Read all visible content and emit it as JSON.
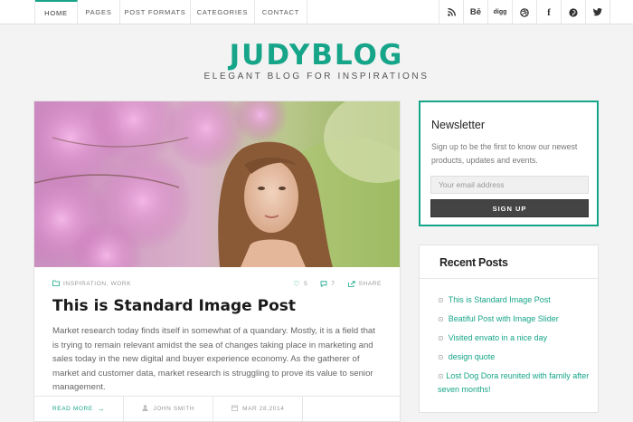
{
  "nav": {
    "items": [
      {
        "label": "HOME",
        "active": true
      },
      {
        "label": "PAGES",
        "active": false
      },
      {
        "label": "POST FORMATS",
        "active": false
      },
      {
        "label": "CATEGORIES",
        "active": false
      },
      {
        "label": "CONTACT",
        "active": false
      }
    ]
  },
  "social": [
    {
      "icon": "rss-icon",
      "glyph": "◉"
    },
    {
      "icon": "behance-icon",
      "glyph": "Bē"
    },
    {
      "icon": "digg-icon",
      "glyph": "digg"
    },
    {
      "icon": "dribbble-icon",
      "glyph": "◎"
    },
    {
      "icon": "facebook-icon",
      "glyph": "f"
    },
    {
      "icon": "pinterest-icon",
      "glyph": "℗"
    },
    {
      "icon": "twitter-icon",
      "glyph": "🐦"
    }
  ],
  "site": {
    "title": "JUDYBLOG",
    "tagline": "ELEGANT BLOG FOR INSPIRATIONS",
    "accent_color": "#17a589"
  },
  "post": {
    "categories": "INSPIRATION, WORK",
    "likes": "5",
    "comments": "7",
    "share_label": "SHARE",
    "title": "This is Standard Image Post",
    "excerpt": "Market research today finds itself in somewhat of a quandary. Mostly, it is a field that is trying to remain relevant amidst the sea of changes taking place in marketing and sales today in the new digital and buyer experience economy. As the gatherer of market and customer data, market research is struggling to prove its value to senior management.",
    "read_more": "READ MORE",
    "author": "JOHN SMITH",
    "date": "MAR 28,2014"
  },
  "newsletter": {
    "title": "Newsletter",
    "text": "Sign up to be the first to know our newest products, updates and events.",
    "email_placeholder": "Your email address",
    "button_label": "SIGN UP"
  },
  "recent_posts": {
    "title": "Recent Posts",
    "items": [
      "This is Standard Image Post",
      "Beatiful Post with Image Slider",
      "Visited envato in a nice day",
      "design quote",
      "Lost Dog Dora reunited with family after seven months!"
    ]
  }
}
